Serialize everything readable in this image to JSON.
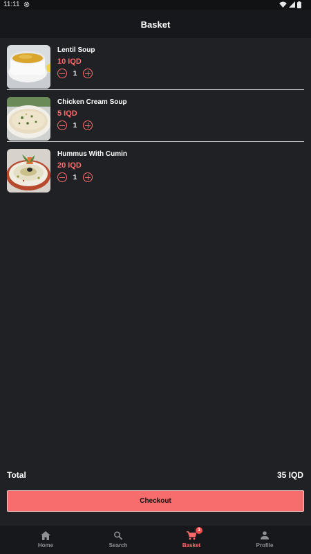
{
  "status_bar": {
    "time": "11:11"
  },
  "app_bar": {
    "title": "Basket"
  },
  "items": [
    {
      "name": "Lentil Soup",
      "price": "10 IQD",
      "quantity": "1",
      "image": "lentil-soup-photo"
    },
    {
      "name": "Chicken Cream Soup",
      "price": "5 IQD",
      "quantity": "1",
      "image": "chicken-cream-soup-photo"
    },
    {
      "name": "Hummus With Cumin",
      "price": "20 IQD",
      "quantity": "1",
      "image": "hummus-photo"
    }
  ],
  "summary": {
    "total_label": "Total",
    "total_value": "35 IQD"
  },
  "checkout_label": "Checkout",
  "bottom_nav": {
    "items": [
      {
        "label": "Home",
        "icon": "home-icon"
      },
      {
        "label": "Search",
        "icon": "search-icon"
      },
      {
        "label": "Basket",
        "icon": "cart-icon",
        "badge": "3"
      },
      {
        "label": "Profile",
        "icon": "person-icon"
      }
    ],
    "active": "Basket"
  },
  "colors": {
    "accent": "#ff6b6b",
    "background": "#202124",
    "bar": "#17181b"
  }
}
